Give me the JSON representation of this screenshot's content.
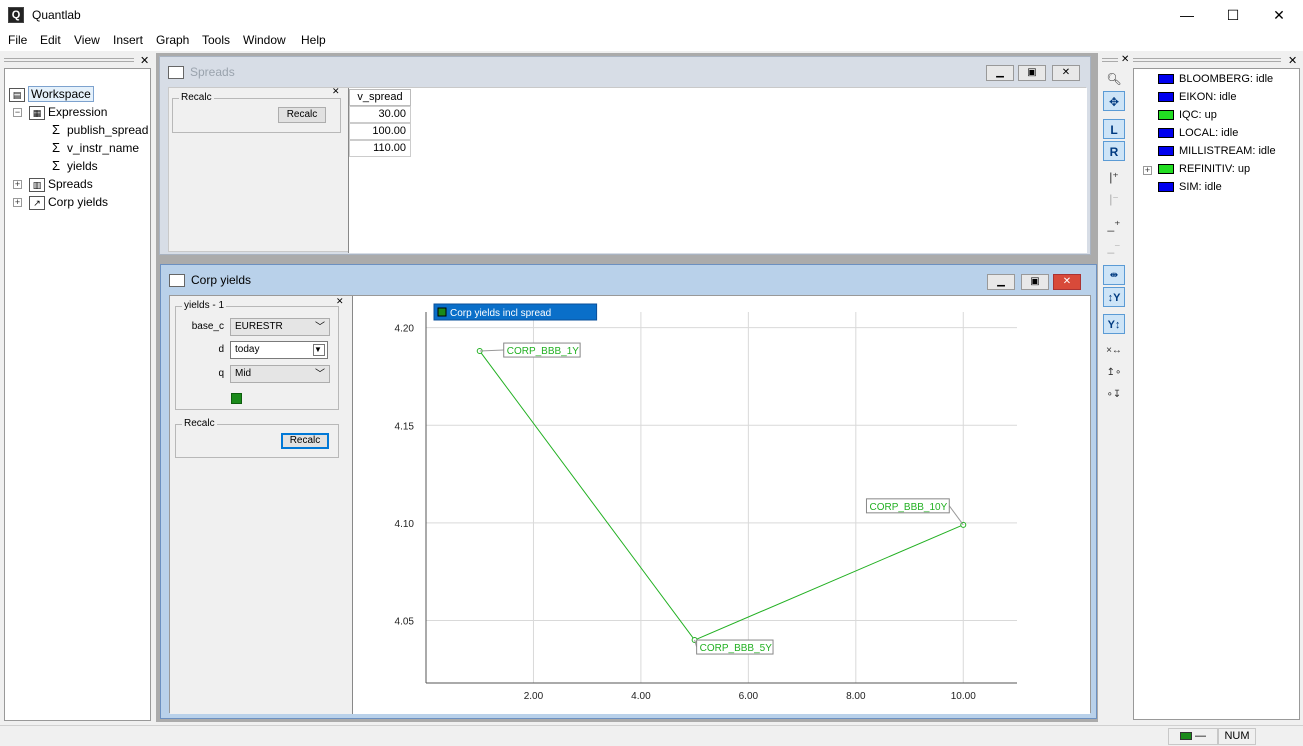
{
  "app": {
    "title": "Quantlab",
    "icon": "quantlab-logo-icon"
  },
  "window_controls": {
    "minimize": "—",
    "maximize": "☐",
    "close": "✕"
  },
  "menu": [
    "File",
    "Edit",
    "View",
    "Insert",
    "Graph",
    "Tools",
    "Window",
    "Help"
  ],
  "tree": {
    "root": "Workspace",
    "items": [
      {
        "label": "Expression",
        "level": 1,
        "icon": "expression-icon"
      },
      {
        "label": "publish_spread",
        "level": 2,
        "icon": "sigma-icon"
      },
      {
        "label": "v_instr_name",
        "level": 2,
        "icon": "sigma-icon"
      },
      {
        "label": "yields",
        "level": 2,
        "icon": "sigma-icon"
      },
      {
        "label": "Spreads",
        "level": 1,
        "icon": "table-icon"
      },
      {
        "label": "Corp yields",
        "level": 1,
        "icon": "chart-icon"
      }
    ]
  },
  "spreads_window": {
    "title": "Spreads",
    "recalc_group": "Recalc",
    "recalc_button": "Recalc",
    "column": "v_spread",
    "values": [
      "30.00",
      "100.00",
      "110.00"
    ]
  },
  "yields_window": {
    "title": "Corp yields",
    "group_label": "yields - 1",
    "fields": {
      "base_c": {
        "label": "base_c",
        "value": "EURESTR"
      },
      "d": {
        "label": "d",
        "value": "today"
      },
      "q": {
        "label": "q",
        "value": "Mid"
      }
    },
    "series_color": "#1a8a1a",
    "recalc_group": "Recalc",
    "recalc_button": "Recalc"
  },
  "chart_data": {
    "type": "line",
    "series": [
      {
        "name": "Corp yields incl spread",
        "color": "#22b022",
        "points": [
          {
            "x": 1.0,
            "y": 4.188,
            "label": "CORP_BBB_1Y"
          },
          {
            "x": 5.0,
            "y": 4.04,
            "label": "CORP_BBB_5Y"
          },
          {
            "x": 10.0,
            "y": 4.099,
            "label": "CORP_BBB_10Y"
          }
        ]
      }
    ],
    "xlim": [
      0.0,
      11.0
    ],
    "ylim": [
      4.018,
      4.208
    ],
    "xticks": [
      2.0,
      4.0,
      6.0,
      8.0,
      10.0
    ],
    "xtick_labels": [
      "2.00",
      "4.00",
      "6.00",
      "8.00",
      "10.00"
    ],
    "yticks": [
      4.05,
      4.1,
      4.15,
      4.2
    ],
    "ytick_labels": [
      "4.05",
      "4.10",
      "4.15",
      "4.20"
    ],
    "grid": true,
    "legend": "top-left"
  },
  "sources": [
    {
      "label": "BLOOMBERG: idle",
      "color": "#0000ee"
    },
    {
      "label": "EIKON: idle",
      "color": "#0000ee"
    },
    {
      "label": "IQC: up",
      "color": "#22dd22"
    },
    {
      "label": "LOCAL: idle",
      "color": "#0000ee"
    },
    {
      "label": "MILLISTREAM: idle",
      "color": "#0000ee"
    },
    {
      "label": "REFINITIV: up",
      "color": "#22dd22"
    },
    {
      "label": "SIM: idle",
      "color": "#0000ee"
    }
  ],
  "toolbar": {
    "left_axis": "L",
    "right_axis": "R",
    "y_label": "Y"
  },
  "status": {
    "num": "NUM",
    "dash": "—"
  }
}
